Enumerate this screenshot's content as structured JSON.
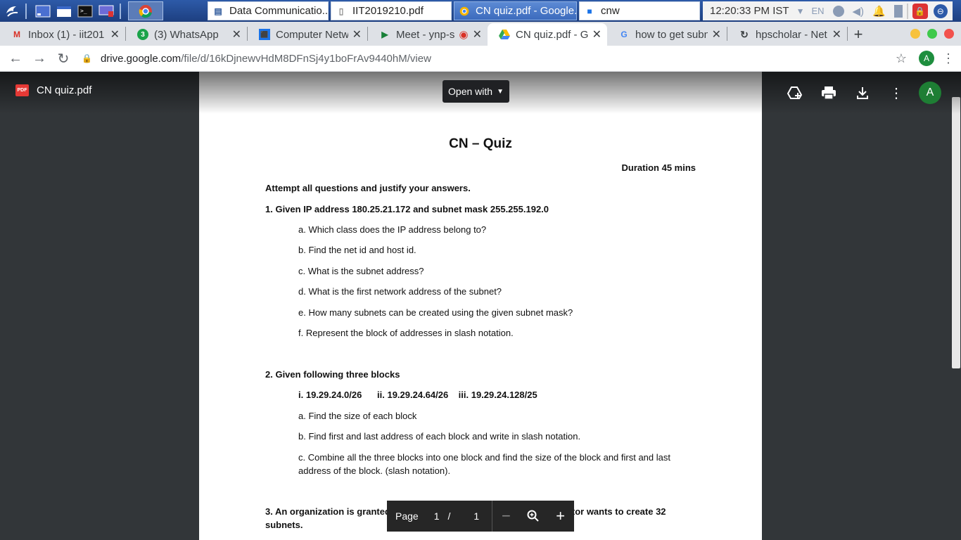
{
  "taskbar": {
    "windows": [
      {
        "label": "Data Communicatio..."
      },
      {
        "label": "IIT2019210.pdf"
      },
      {
        "label": "CN quiz.pdf - Google..."
      },
      {
        "label": "cnw"
      }
    ],
    "clock": "12:20:33 PM IST",
    "lang": "EN"
  },
  "tabs": [
    {
      "title": "Inbox (1) - iit201",
      "favicon": "M",
      "color": "#d93025"
    },
    {
      "title": "(3) WhatsApp",
      "favicon": "3",
      "color": "#1aa34a"
    },
    {
      "title": "Computer Netw",
      "favicon": "👤",
      "color": "#1a73e8"
    },
    {
      "title": "Meet - ynp-s",
      "favicon": "▶",
      "color": "#188038"
    },
    {
      "title": "CN quiz.pdf - G",
      "favicon": "▲",
      "color": "#1a73e8"
    },
    {
      "title": "how to get subn",
      "favicon": "G",
      "color": "#4285f4"
    },
    {
      "title": "hpscholar - Net",
      "favicon": "↻",
      "color": "#3c4043"
    }
  ],
  "address": {
    "host": "drive.google.com",
    "path": "/file/d/16kDjnewvHdM8DFnSj4y1boFrAv9440hM/view",
    "profile_letter": "A"
  },
  "viewer": {
    "file_name": "CN quiz.pdf",
    "badge": "PDF",
    "open_with": "Open with",
    "account_letter": "A"
  },
  "doc": {
    "title": "CN – Quiz",
    "duration": "Duration 45 mins",
    "instruction": "Attempt all questions and justify your answers.",
    "q1": "1. Given IP address 180.25.21.172 and subnet mask 255.255.192.0",
    "q1_parts": [
      "a. Which class does the IP address belong to?",
      "b. Find the net id and host id.",
      "c. What is the subnet address?",
      "d. What is the first network address of the subnet?",
      "e. How many subnets can be created using the given subnet mask?",
      "f. Represent the block of addresses in slash notation."
    ],
    "q2": "2. Given following three blocks",
    "q2_blocks": "i. 19.29.24.0/26      ii. 19.29.24.64/26    iii. 19.29.24.128/25",
    "q2_parts": [
      "a. Find the size of each block",
      "b. Find first and last address of each block and write in slash notation.",
      "c. Combine all the three blocks into one block and find the size of the block and first and last address of the block. (slash notation)."
    ],
    "q3": "3. An organization is granted the block 217.19.180.0/24. The administrator wants to create 32 subnets."
  },
  "page_control": {
    "label": "Page",
    "current": "1",
    "separator": "/",
    "total": "1"
  }
}
